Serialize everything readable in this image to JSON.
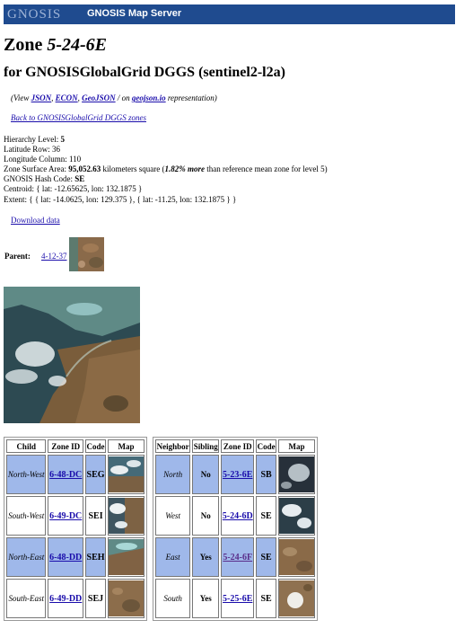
{
  "header": {
    "logo_text": "GNOSIS",
    "app_title": "GNOSIS Map Server"
  },
  "zone": {
    "title_prefix": "Zone",
    "zone_id": "5-24-6E",
    "subtitle": "for GNOSISGlobalGrid DGGS (sentinel2-l2a)"
  },
  "representations": {
    "view_prefix": "(View",
    "links": [
      "JSON",
      "ECON",
      "GeoJSON"
    ],
    "on_text": "/ on",
    "site": "geojson.io",
    "suffix": "representation)"
  },
  "back_link": "Back to GNOSISGlobalGrid DGGS zones",
  "properties": {
    "hierarchy_label": "Hierarchy Level:",
    "hierarchy_value": "5",
    "lat_row_label": "Latitude Row:",
    "lat_row_value": "36",
    "lon_col_label": "Longitude Column:",
    "lon_col_value": "110",
    "area_label": "Zone Surface Area:",
    "area_value": "95,052.63",
    "area_unit": "kilometers square (",
    "area_pct": "1.82% more",
    "area_suffix": "than reference mean zone for level 5)",
    "hash_label": "GNOSIS Hash Code:",
    "hash_value": "SE",
    "centroid": "Centroid: { lat: -12.65625, lon: 132.1875 }",
    "extent": "Extent: { { lat: -14.0625, lon: 129.375 }, { lat: -11.25, lon: 132.1875 } }"
  },
  "download_label": "Download data",
  "parent": {
    "label": "Parent:",
    "zone_id": "4-12-37"
  },
  "children_table": {
    "headers": [
      "Child",
      "Zone ID",
      "Code",
      "Map"
    ],
    "rows": [
      {
        "direction": "North-West",
        "zone_id": "6-48-DC",
        "code": "SEG"
      },
      {
        "direction": "South-West",
        "zone_id": "6-49-DC",
        "code": "SEI"
      },
      {
        "direction": "North-East",
        "zone_id": "6-48-DD",
        "code": "SEH"
      },
      {
        "direction": "South-East",
        "zone_id": "6-49-DD",
        "code": "SEJ"
      }
    ]
  },
  "neighbors_table": {
    "headers": [
      "Neighbor",
      "Sibling",
      "Zone ID",
      "Code",
      "Map"
    ],
    "rows": [
      {
        "direction": "North",
        "sibling": "No",
        "zone_id": "5-23-6E",
        "code": "SB"
      },
      {
        "direction": "West",
        "sibling": "No",
        "zone_id": "5-24-6D",
        "code": "SE"
      },
      {
        "direction": "East",
        "sibling": "Yes",
        "zone_id": "5-24-6F",
        "code": "SE"
      },
      {
        "direction": "South",
        "sibling": "Yes",
        "zone_id": "5-25-6E",
        "code": "SE"
      }
    ]
  },
  "colors": {
    "header_bar": "#1f4b8f",
    "highlight_row": "#9fb8ea",
    "link": "#1a0dab"
  }
}
